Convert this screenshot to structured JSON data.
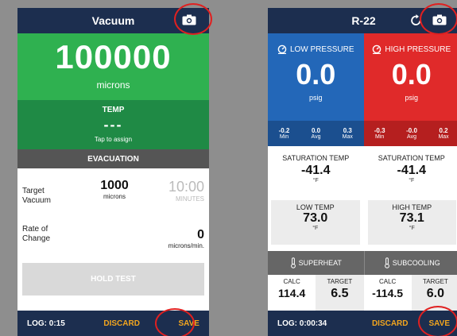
{
  "vacuum_screen": {
    "title": "Vacuum",
    "reading": "100000",
    "reading_unit": "microns",
    "temp": {
      "label": "TEMP",
      "value": "---",
      "hint": "Tap to assign"
    },
    "section": "EVACUATION",
    "target_vacuum": {
      "label_line1": "Target",
      "label_line2": "Vacuum",
      "value": "1000",
      "unit": "microns"
    },
    "timer": {
      "value": "10:00",
      "unit": "MINUTES"
    },
    "rate": {
      "label_line1": "Rate of",
      "label_line2": "Change",
      "value": "0",
      "unit": "microns/min."
    },
    "hold_button": "HOLD TEST",
    "footer": {
      "log": "LOG: 0:15",
      "discard": "DISCARD",
      "save": "SAVE"
    }
  },
  "r22_screen": {
    "title": "R-22",
    "low": {
      "label": "LOW PRESSURE",
      "value": "0.0",
      "unit": "psig",
      "min": "-0.2",
      "avg": "0.0",
      "max": "0.3"
    },
    "high": {
      "label": "HIGH PRESSURE",
      "value": "0.0",
      "unit": "psig",
      "min": "-0.3",
      "avg": "-0.0",
      "max": "0.2"
    },
    "stat_labels": {
      "min": "Min",
      "avg": "Avg",
      "max": "Max"
    },
    "sat_low": {
      "label": "SATURATION TEMP",
      "value": "-41.4",
      "unit": "°F"
    },
    "sat_high": {
      "label": "SATURATION TEMP",
      "value": "-41.4",
      "unit": "°F"
    },
    "low_temp": {
      "label": "LOW TEMP",
      "value": "73.0",
      "unit": "°F"
    },
    "high_temp": {
      "label": "HIGH TEMP",
      "value": "73.1",
      "unit": "°F"
    },
    "superheat_label": "SUPERHEAT",
    "subcooling_label": "SUBCOOLING",
    "calc_label": "CALC",
    "target_label": "TARGET",
    "superheat_calc": "114.4",
    "superheat_target": "6.5",
    "subcooling_calc": "-114.5",
    "subcooling_target": "6.0",
    "footer": {
      "log": "LOG: 0:00:34",
      "discard": "DISCARD",
      "save": "SAVE"
    }
  },
  "colors": {
    "navy": "#1c2e4f",
    "green": "#2fb150",
    "dark_green": "#1f8a45",
    "blue": "#2367b8",
    "red": "#e02a2a",
    "accent": "#f2a51e",
    "highlight_circle": "#e02020"
  },
  "icons": [
    "camera-icon",
    "refresh-icon",
    "gauge-icon",
    "thermometer-icon"
  ]
}
